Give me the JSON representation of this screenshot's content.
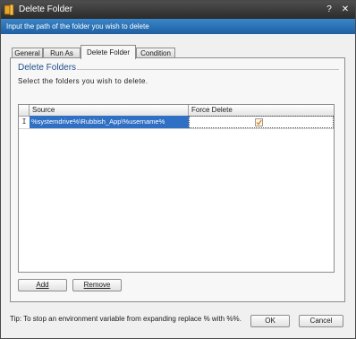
{
  "window": {
    "title": "Delete Folder",
    "help_glyph": "?",
    "close_glyph": "✕"
  },
  "banner": {
    "text": "Input the path of the folder you wish to delete"
  },
  "tabs": [
    {
      "label": "General",
      "active": false
    },
    {
      "label": "Run As",
      "active": false
    },
    {
      "label": "Delete Folder",
      "active": true
    },
    {
      "label": "Condition",
      "active": false
    }
  ],
  "group": {
    "title": "Delete Folders",
    "instruction": "Select the folders you wish to delete."
  },
  "grid": {
    "columns": [
      "Source",
      "Force Delete"
    ],
    "rows": [
      {
        "marker": "I",
        "source": "%systemdrive%\\Rubbish_App\\%username%",
        "force_delete": true
      }
    ]
  },
  "buttons": {
    "add": "Add",
    "remove": "Remove",
    "ok": "OK",
    "cancel": "Cancel"
  },
  "tip": "Tip: To stop an environment variable from expanding replace % with %%.",
  "colors": {
    "title_bar": "#2b2b2b",
    "banner": "#2a72b8",
    "selection": "#2f6fc4",
    "check": "#e8821e"
  }
}
